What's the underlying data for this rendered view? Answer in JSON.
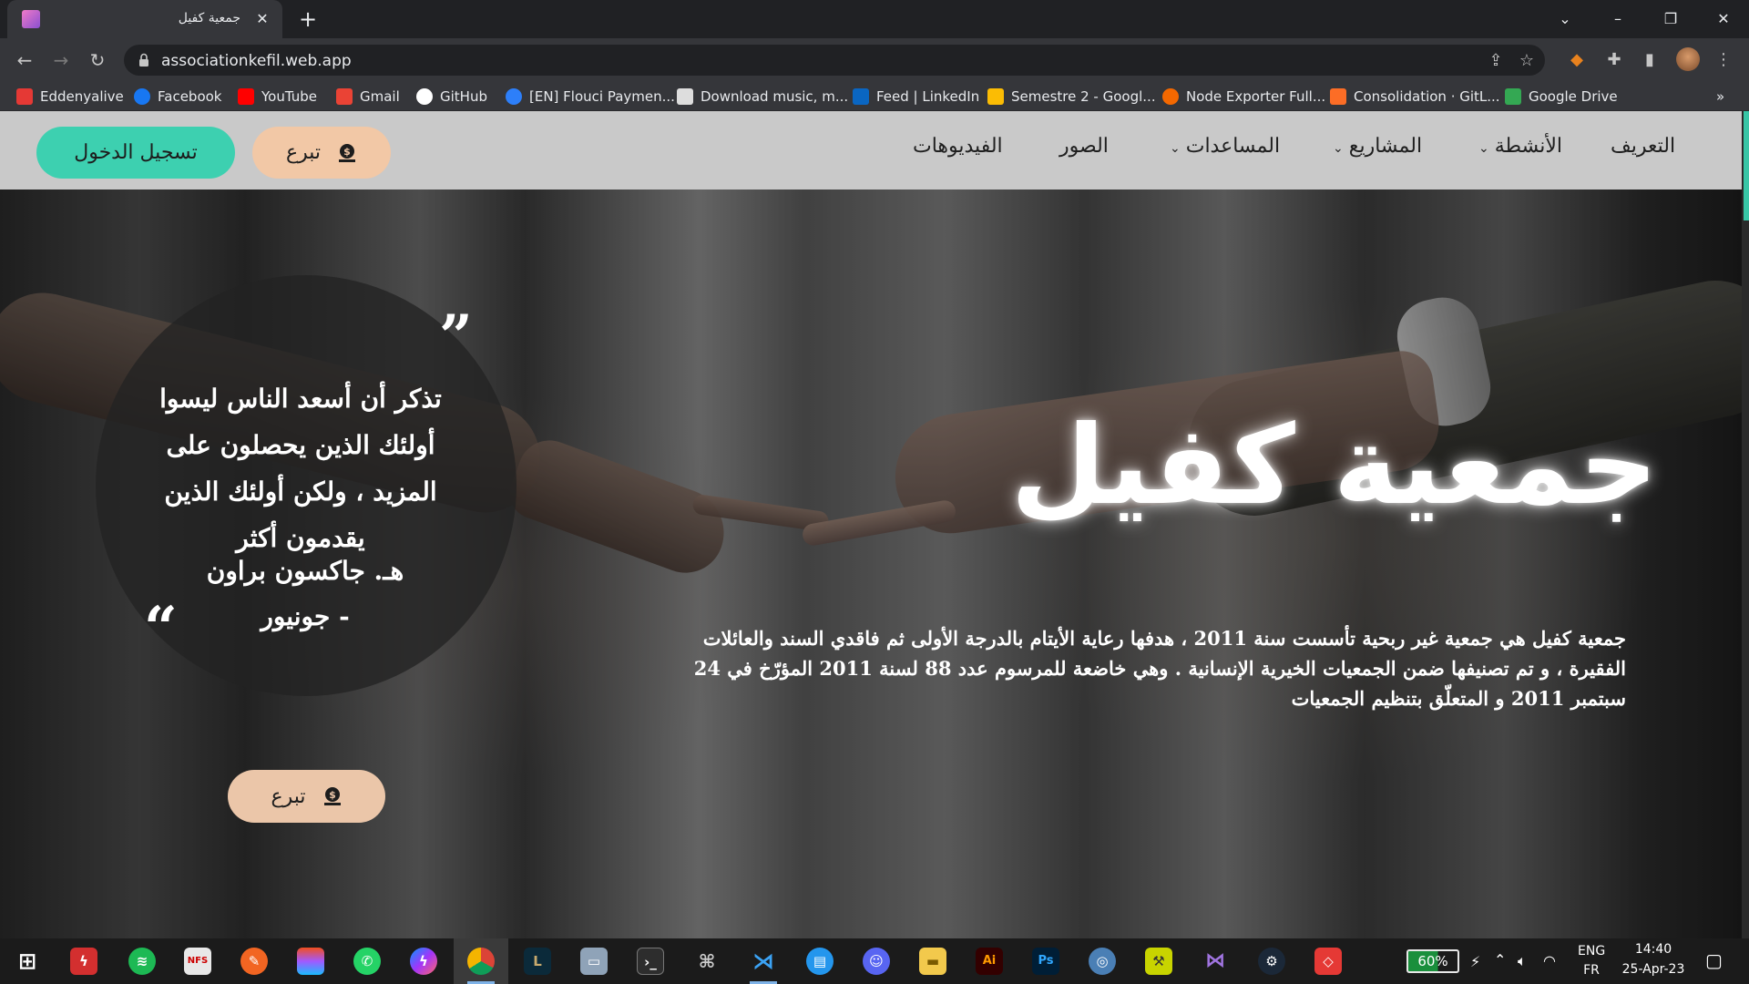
{
  "browser": {
    "tab_title": "جمعية كفيل",
    "url": "associationkefil.web.app",
    "bookmarks": [
      {
        "label": "Eddenyalive",
        "color": "#e53935"
      },
      {
        "label": "Facebook",
        "color": "#1877f2"
      },
      {
        "label": "YouTube",
        "color": "#ff0000"
      },
      {
        "label": "Gmail",
        "color": "#ea4335"
      },
      {
        "label": "GitHub",
        "color": "#ffffff"
      },
      {
        "label": "[EN] Flouci Paymen...",
        "color": "#2d7ff9"
      },
      {
        "label": "Download music, m...",
        "color": "#dddddd"
      },
      {
        "label": "Feed | LinkedIn",
        "color": "#0a66c2"
      },
      {
        "label": "Semestre 2 - Googl...",
        "color": "#fbbc04"
      },
      {
        "label": "Node Exporter Full...",
        "color": "#f46800"
      },
      {
        "label": "Consolidation · GitL...",
        "color": "#fc6d26"
      },
      {
        "label": "Google Drive",
        "color": "#34a853"
      }
    ]
  },
  "nav": {
    "links": [
      {
        "label": "التعريف",
        "dropdown": false
      },
      {
        "label": "الأنشطة",
        "dropdown": true
      },
      {
        "label": "المشاريع",
        "dropdown": true
      },
      {
        "label": "المساعدات",
        "dropdown": true
      },
      {
        "label": "الصور",
        "dropdown": false
      },
      {
        "label": "الفيديوهات",
        "dropdown": false
      }
    ],
    "login_label": "تسجيل الدخول",
    "donate_label": "تبرع"
  },
  "hero": {
    "title": "جمعية كفيل",
    "description": "جمعية كفيل هي جمعية غير ربحية تأسست سنة 2011 ، هدفها رعاية الأيتام بالدرجة الأولى ثم فاقدي السند والعائلات الفقيرة ، و تم تصنيفها ضمن الجمعيات الخيرية الإنسانية . وهي خاضعة للمرسوم عدد 88 لسنة 2011 المؤرّخ في 24 سبتمبر 2011 و المتعلّق بتنظيم الجمعيات",
    "quote": "تذكر أن أسعد الناس ليسوا أولئك الذين يحصلون على المزيد ، ولكن أولئك الذين يقدمون أكثر",
    "quote_author": "هـ. جاكسون براون - جونيور",
    "quote_open": "”",
    "quote_close": "“",
    "donate_label": "تبرع"
  },
  "taskbar": {
    "battery": "60%",
    "language": "ENG",
    "region": "FR",
    "time": "14:40",
    "date": "25-Apr-23"
  },
  "colors": {
    "accent_teal": "#3dd0b0",
    "donate_peach": "#f2c8a6"
  }
}
